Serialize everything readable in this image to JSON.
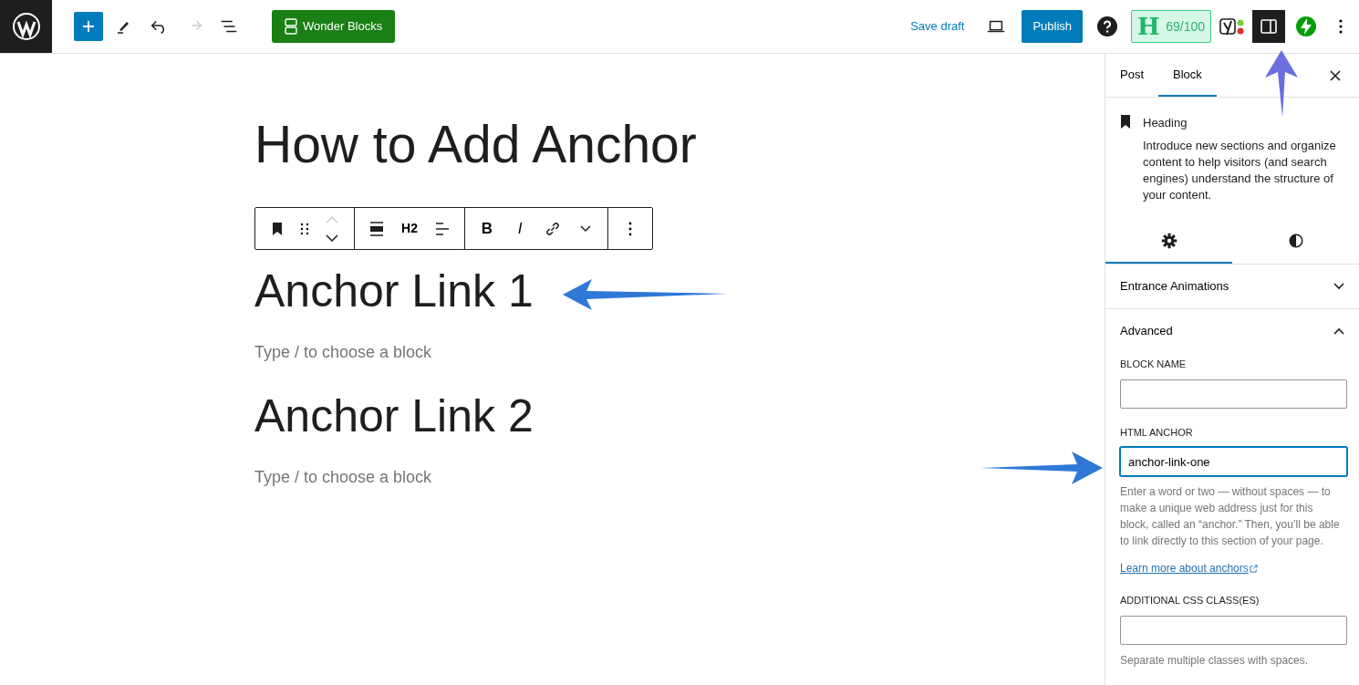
{
  "topbar": {
    "history": [
      {
        "kind": "undo",
        "disabled": false
      },
      {
        "kind": "redo",
        "disabled": true
      }
    ],
    "wonder_blocks": "Wonder Blocks",
    "save_draft": "Save draft",
    "publish": "Publish",
    "seo_letter": "H",
    "seo_score": "69/100",
    "sidebar_toggle": {
      "pressed": true
    }
  },
  "editor": {
    "title": "How to Add Anchor",
    "block_toolbar": {
      "heading_level": "H2",
      "format_buttons": [
        "B",
        "I"
      ]
    },
    "blocks": [
      {
        "kind": "heading",
        "text": "Anchor Link 1"
      },
      {
        "kind": "placeholder",
        "text": "Type / to choose a block"
      },
      {
        "kind": "heading",
        "text": "Anchor Link 2"
      },
      {
        "kind": "placeholder",
        "text": "Type / to choose a block"
      }
    ]
  },
  "sidebar": {
    "tabs": [
      {
        "label": "Post",
        "selected": false
      },
      {
        "label": "Block",
        "selected": true
      }
    ],
    "block_card": {
      "title": "Heading",
      "description": "Introduce new sections and organize content to help visitors (and search engines) understand the structure of your content."
    },
    "style_tabs": [
      {
        "kind": "settings",
        "selected": true
      },
      {
        "kind": "styles",
        "selected": false
      }
    ],
    "panels": [
      {
        "title": "Entrance Animations",
        "expanded": false
      },
      {
        "title": "Advanced",
        "expanded": true,
        "fields": [
          {
            "label": "BLOCK NAME",
            "focused": false
          },
          {
            "label": "HTML ANCHOR",
            "value": "anchor-link-one",
            "focused": true,
            "help": "Enter a word or two — without spaces — to make a unique web address just for this block, called an “anchor.” Then, you’ll be able to link directly to this section of your page.",
            "link": "Learn more about anchors"
          },
          {
            "label": "ADDITIONAL CSS CLASS(ES)",
            "focused": false,
            "help": "Separate multiple classes with spaces."
          }
        ]
      }
    ]
  }
}
